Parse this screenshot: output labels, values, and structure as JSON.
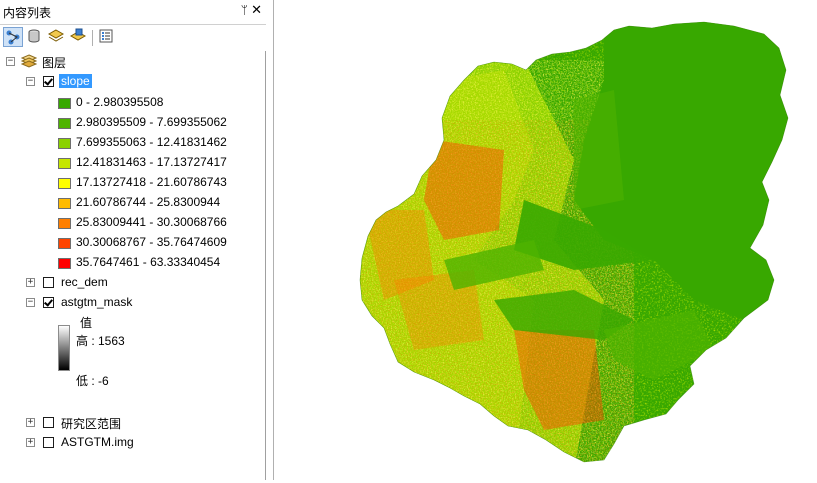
{
  "toc": {
    "title": "内容列表",
    "pin_glyph": "ᛘ",
    "close_glyph": "✕",
    "toolbar": [
      {
        "name": "list-by-drawing-order-button",
        "icon": "layers-tree-icon",
        "active": true
      },
      {
        "name": "list-by-source-button",
        "icon": "database-icon",
        "active": false
      },
      {
        "name": "list-by-visibility-button",
        "icon": "visibility-layers-icon",
        "active": false
      },
      {
        "name": "list-by-selection-button",
        "icon": "selection-layers-icon",
        "active": false
      },
      {
        "name": "options-button",
        "icon": "options-list-icon",
        "active": false
      }
    ],
    "group": {
      "label": "图层",
      "expand": "−"
    },
    "layers": {
      "slope": {
        "label": "slope",
        "expand": "−",
        "checked": true,
        "classes": [
          {
            "label": "0 - 2.980395508",
            "color": "#38a800"
          },
          {
            "label": "2.980395509 - 7.699355062",
            "color": "#4fb300"
          },
          {
            "label": "7.699355063 - 12.41831462",
            "color": "#8bd100"
          },
          {
            "label": "12.41831463 - 17.13727417",
            "color": "#c5e600"
          },
          {
            "label": "17.13727418 - 21.60786743",
            "color": "#ffff00"
          },
          {
            "label": "21.60786744 - 25.8300944",
            "color": "#ffbb00"
          },
          {
            "label": "25.83009441 - 30.30068766",
            "color": "#ff7f00"
          },
          {
            "label": "30.30068767 - 35.76474609",
            "color": "#ff4400"
          },
          {
            "label": "35.7647461 - 63.33340454",
            "color": "#ff0000"
          }
        ]
      },
      "rec_dem": {
        "label": "rec_dem",
        "expand": "+",
        "checked": false
      },
      "astgtm_mask": {
        "label": "astgtm_mask",
        "expand": "−",
        "checked": true,
        "value_heading": "值",
        "high": "高 : 1563",
        "low": "低 : -6"
      },
      "study_area": {
        "label": "研究区范围",
        "expand": "+",
        "checked": false
      },
      "astgtm_img": {
        "label": "ASTGTM.img",
        "expand": "+",
        "checked": false
      }
    }
  },
  "map": {
    "description_colors": {
      "flat": "#38a800",
      "steep": "#ff0000",
      "mid": "#ffff00"
    }
  }
}
